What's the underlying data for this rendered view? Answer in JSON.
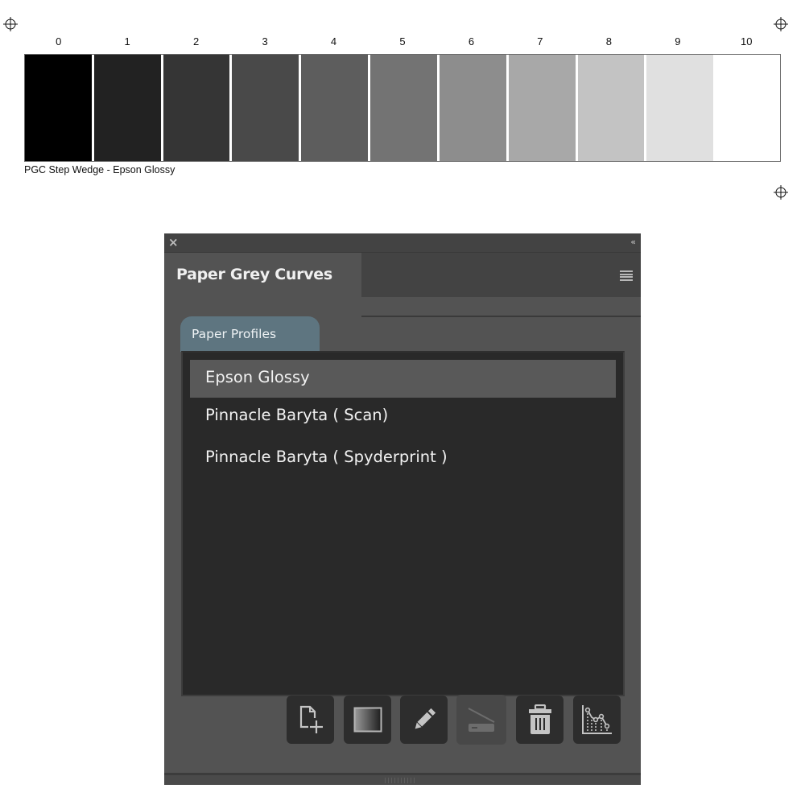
{
  "step_wedge": {
    "labels": [
      "0",
      "1",
      "2",
      "3",
      "4",
      "5",
      "6",
      "7",
      "8",
      "9",
      "10"
    ],
    "patch_colors": [
      "#000000",
      "#222222",
      "#353535",
      "#494949",
      "#5d5d5d",
      "#737373",
      "#8d8d8d",
      "#a8a8a8",
      "#c3c3c3",
      "#e0e0e0",
      "#ffffff"
    ],
    "caption": "PGC Step Wedge - Epson Glossy"
  },
  "registration_marks": [
    "crosshair-target-icon",
    "crosshair-target-icon",
    "crosshair-target-icon"
  ],
  "panel": {
    "close_icon": "×",
    "collapse_icon": "‹‹",
    "title": "Paper Grey Curves",
    "menu_icon": "hamburger-menu-icon",
    "sub_tab": "Paper Profiles",
    "profiles": [
      {
        "name": "Epson Glossy",
        "selected": true
      },
      {
        "name": "Pinnacle Baryta ( Scan)",
        "selected": false
      },
      {
        "name": "Pinnacle Baryta ( Spyderprint )",
        "selected": false
      }
    ],
    "toolbar": [
      {
        "icon": "new-document-icon",
        "enabled": true
      },
      {
        "icon": "gradient-wedge-icon",
        "enabled": true
      },
      {
        "icon": "pencil-edit-icon",
        "enabled": true
      },
      {
        "icon": "scanner-icon",
        "enabled": false
      },
      {
        "icon": "trash-icon",
        "enabled": true
      },
      {
        "icon": "curve-chart-icon",
        "enabled": true
      }
    ],
    "colors": {
      "panel_bg": "#535353",
      "list_bg": "#292929",
      "selection_bg": "#595959",
      "sub_tab_bg": "#5e7580"
    }
  }
}
